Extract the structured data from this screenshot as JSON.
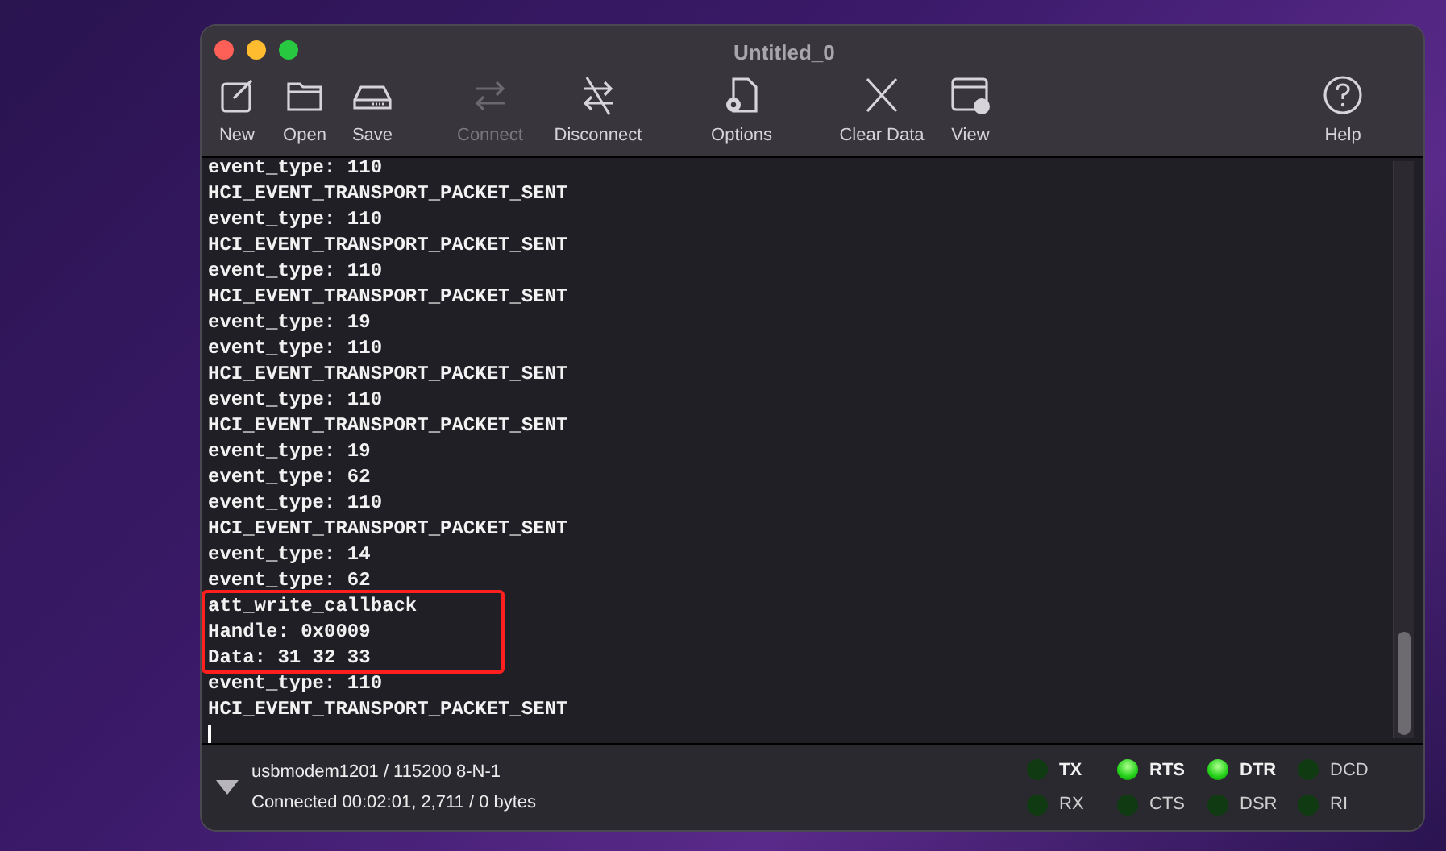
{
  "window": {
    "title": "Untitled_0"
  },
  "toolbar": [
    {
      "label": "New",
      "kind": "new",
      "disabled": false
    },
    {
      "label": "Open",
      "kind": "open",
      "disabled": false
    },
    {
      "label": "Save",
      "kind": "save",
      "disabled": false
    },
    {
      "label": "Connect",
      "kind": "connect",
      "disabled": true
    },
    {
      "label": "Disconnect",
      "kind": "disconnect",
      "disabled": false
    },
    {
      "label": "Options",
      "kind": "options",
      "disabled": false
    },
    {
      "label": "Clear Data",
      "kind": "clear",
      "disabled": false
    },
    {
      "label": "View",
      "kind": "view",
      "disabled": false
    },
    {
      "label": "Help",
      "kind": "help",
      "disabled": false
    }
  ],
  "terminal": [
    {
      "kind": "line",
      "text": "event_type: 110"
    },
    {
      "kind": "line",
      "text": "HCI_EVENT_TRANSPORT_PACKET_SENT"
    },
    {
      "kind": "line",
      "text": "event_type: 110"
    },
    {
      "kind": "line",
      "text": "HCI_EVENT_TRANSPORT_PACKET_SENT"
    },
    {
      "kind": "line",
      "text": "event_type: 110"
    },
    {
      "kind": "line",
      "text": "HCI_EVENT_TRANSPORT_PACKET_SENT"
    },
    {
      "kind": "line",
      "text": "event_type: 19"
    },
    {
      "kind": "line",
      "text": "event_type: 110"
    },
    {
      "kind": "line",
      "text": "HCI_EVENT_TRANSPORT_PACKET_SENT"
    },
    {
      "kind": "line",
      "text": "event_type: 110"
    },
    {
      "kind": "line",
      "text": "HCI_EVENT_TRANSPORT_PACKET_SENT"
    },
    {
      "kind": "line",
      "text": "event_type: 19"
    },
    {
      "kind": "line",
      "text": "event_type: 62"
    },
    {
      "kind": "line",
      "text": "event_type: 110"
    },
    {
      "kind": "line",
      "text": "HCI_EVENT_TRANSPORT_PACKET_SENT"
    },
    {
      "kind": "line",
      "text": "event_type: 14"
    },
    {
      "kind": "line",
      "text": "event_type: 62"
    },
    {
      "kind": "highlight",
      "lines": [
        "att_write_callback",
        "Handle: 0x0009",
        "Data: 31 32 33"
      ]
    },
    {
      "kind": "line",
      "text": "event_type: 110"
    },
    {
      "kind": "line",
      "text": "HCI_EVENT_TRANSPORT_PACKET_SENT"
    }
  ],
  "status_bar": {
    "port": "usbmodem1201 / 115200 8-N-1",
    "connection": "Connected 00:02:01, 2,711 / 0 bytes",
    "signals": [
      {
        "label": "TX",
        "on": false,
        "kind": "output"
      },
      {
        "label": "RTS",
        "on": true,
        "kind": "output"
      },
      {
        "label": "DTR",
        "on": true,
        "kind": "output"
      },
      {
        "label": "DCD",
        "on": false,
        "kind": "input"
      },
      {
        "label": "RX",
        "on": false,
        "kind": "input"
      },
      {
        "label": "CTS",
        "on": false,
        "kind": "input"
      },
      {
        "label": "DSR",
        "on": false,
        "kind": "input"
      },
      {
        "label": "RI",
        "on": false,
        "kind": "input"
      }
    ]
  }
}
